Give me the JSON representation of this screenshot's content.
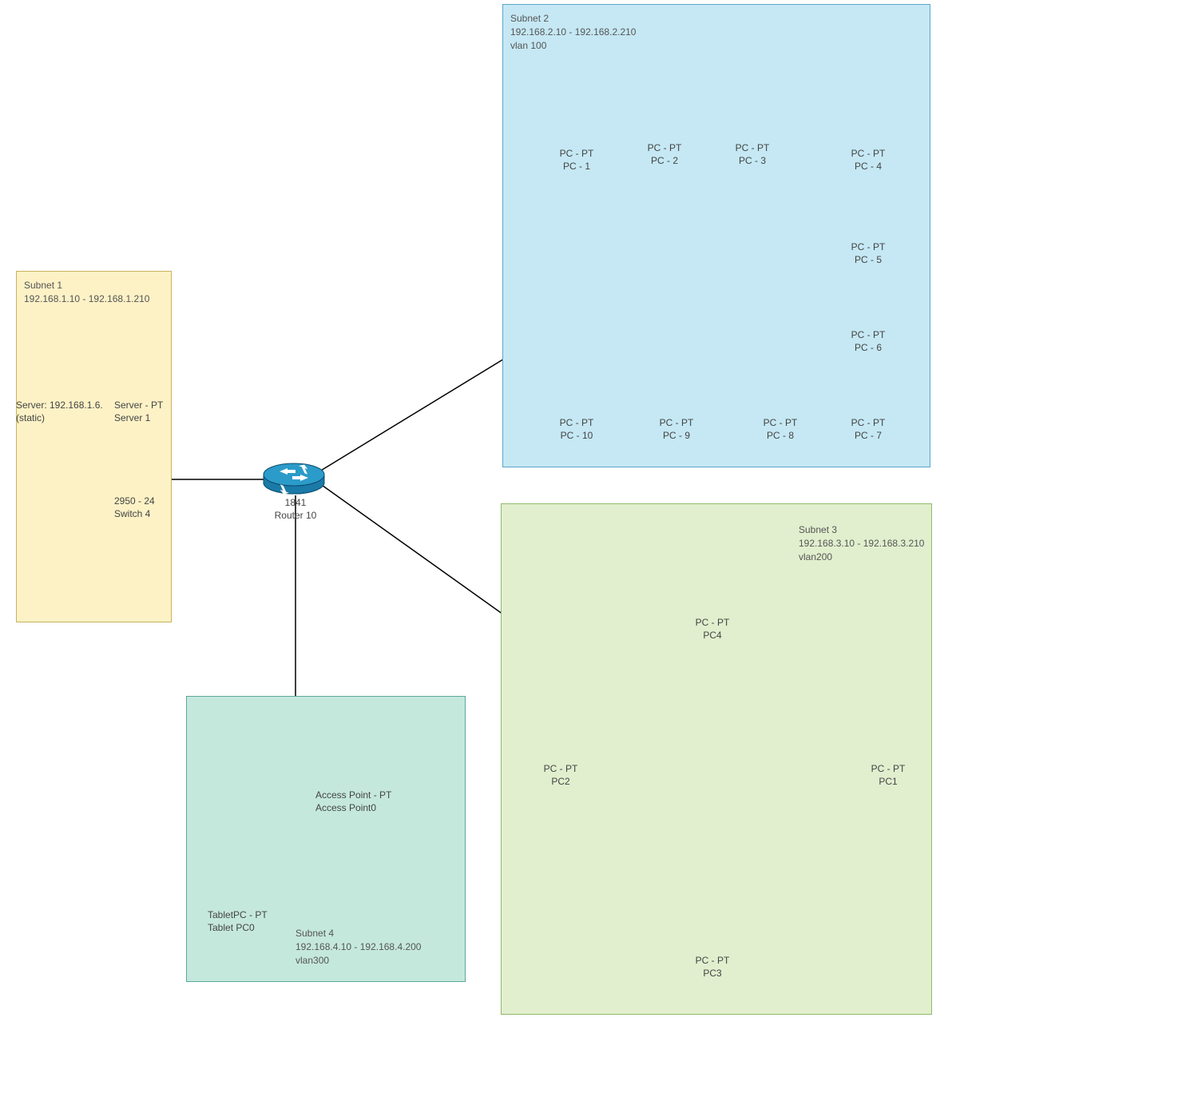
{
  "subnet1": {
    "title": "Subnet 1",
    "range": "192.168.1.10 - 192.168.1.210",
    "server_info1": "Server: 192.168.1.6.",
    "server_info2": "(static)",
    "server_label1": "Server - PT",
    "server_label2": "Server 1",
    "switch_label1": "2950 - 24",
    "switch_label2": "Switch 4"
  },
  "router": {
    "model": "1841",
    "name": "Router 10"
  },
  "subnet2": {
    "title": "Subnet 2",
    "range": "192.168.2.10 - 192.168.2.210",
    "vlan": "vlan 100",
    "pc1_t": "PC - PT",
    "pc1_n": "PC - 1",
    "pc2_t": "PC - PT",
    "pc2_n": "PC - 2",
    "pc3_t": "PC - PT",
    "pc3_n": "PC - 3",
    "pc4_t": "PC - PT",
    "pc4_n": "PC - 4",
    "pc5_t": "PC - PT",
    "pc5_n": "PC - 5",
    "pc6_t": "PC - PT",
    "pc6_n": "PC - 6",
    "pc7_t": "PC - PT",
    "pc7_n": "PC - 7",
    "pc8_t": "PC - PT",
    "pc8_n": "PC - 8",
    "pc9_t": "PC - PT",
    "pc9_n": "PC - 9",
    "pc10_t": "PC - PT",
    "pc10_n": "PC - 10"
  },
  "subnet3": {
    "title": "Subnet 3",
    "range": "192.168.3.10 - 192.168.3.210",
    "vlan": "vlan200",
    "pc1_t": "PC - PT",
    "pc1_n": "PC1",
    "pc2_t": "PC - PT",
    "pc2_n": "PC2",
    "pc3_t": "PC - PT",
    "pc3_n": "PC3",
    "pc4_t": "PC - PT",
    "pc4_n": "PC4"
  },
  "subnet4": {
    "title": "Subnet 4",
    "range": "192.168.4.10 - 192.168.4.200",
    "vlan": "vlan300",
    "ap_t": "Access Point - PT",
    "ap_n": "Access Point0",
    "tablet_t": "TabletPC - PT",
    "tablet_n": "Tablet PC0"
  }
}
